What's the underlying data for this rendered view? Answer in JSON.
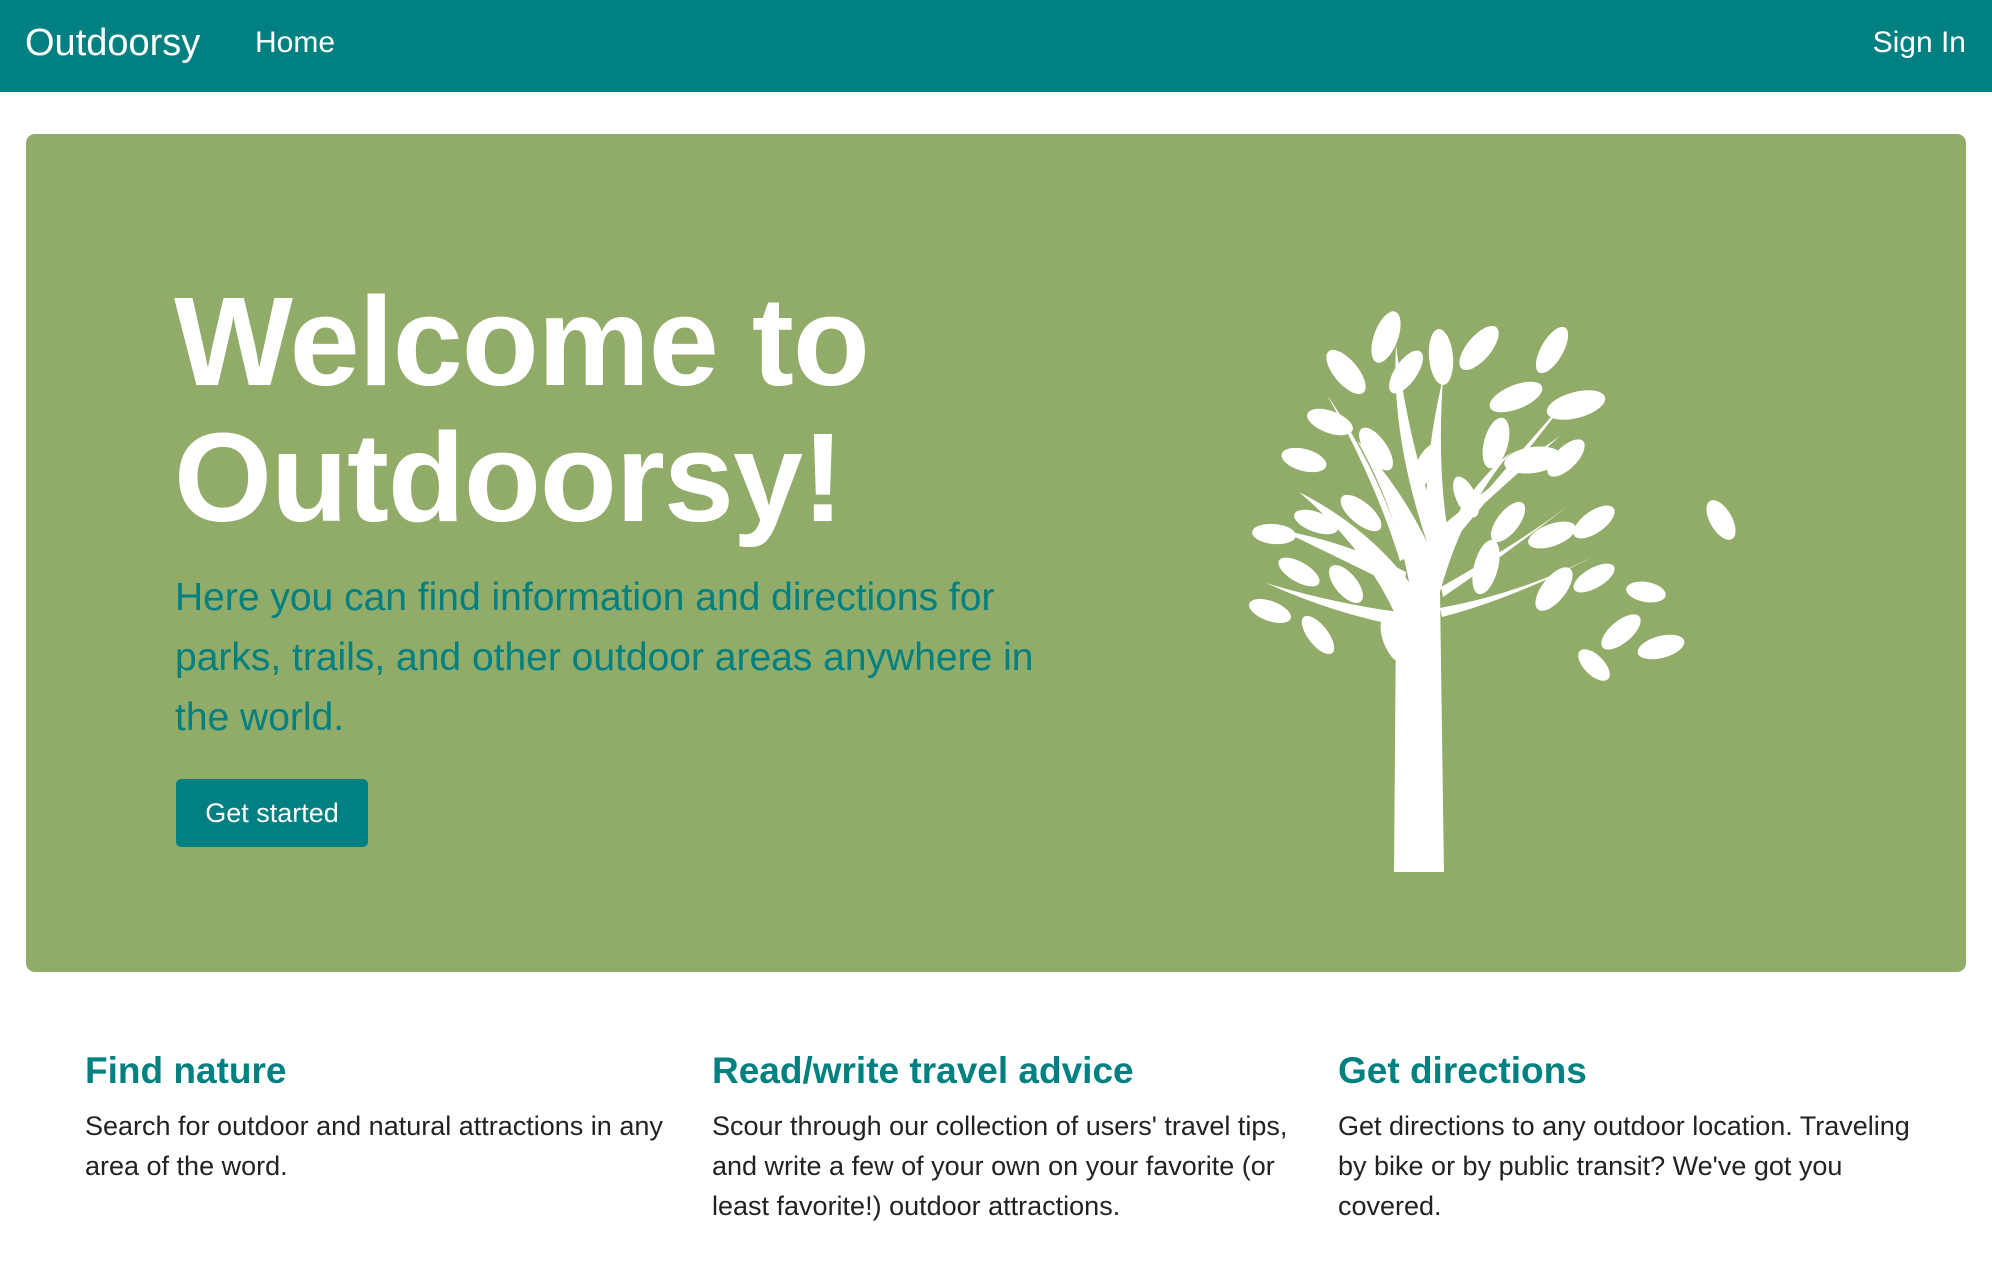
{
  "nav": {
    "brand": "Outdoorsy",
    "home": "Home",
    "sign_in": "Sign In"
  },
  "hero": {
    "title_line1": "Welcome to",
    "title_line2": "Outdoorsy!",
    "lead": "Here you can find information and directions for parks, trails, and other outdoor areas anywhere in the world.",
    "button": "Get started",
    "image_icon": "tree-icon"
  },
  "features": [
    {
      "title": "Find nature",
      "text": "Search for outdoor and natural attractions in any area of the word."
    },
    {
      "title": "Read/write travel advice",
      "text": "Scour through our collection of users' travel tips, and write a few of your own on your favorite (or least favorite!) outdoor attractions."
    },
    {
      "title": "Get directions",
      "text": "Get directions to any outdoor location. Traveling by bike or by public transit? We've got you covered."
    }
  ],
  "colors": {
    "brand": "#008080",
    "hero_background": "#91ab69",
    "text": "#222222",
    "white": "#ffffff"
  }
}
